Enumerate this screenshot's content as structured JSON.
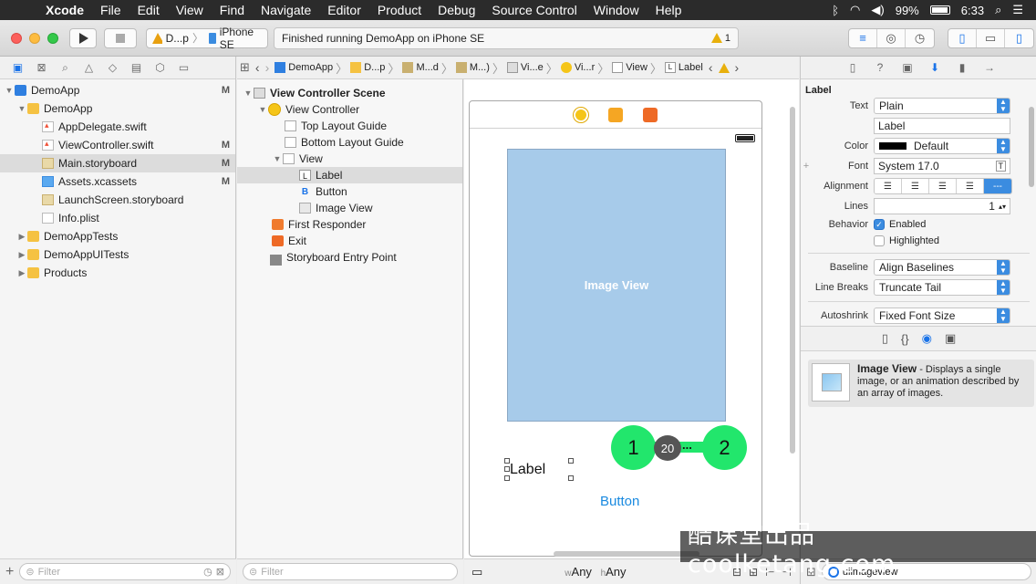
{
  "menubar": {
    "app_name": "Xcode",
    "menus": [
      "File",
      "Edit",
      "View",
      "Find",
      "Navigate",
      "Editor",
      "Product",
      "Debug",
      "Source Control",
      "Window",
      "Help"
    ],
    "battery": "99%",
    "clock": "6:33"
  },
  "toolbar": {
    "scheme_app": "D...p",
    "scheme_device": "iPhone SE",
    "activity_text": "Finished running DemoApp on iPhone SE",
    "warning_count": "1"
  },
  "navigator": {
    "items": [
      {
        "label": "DemoApp",
        "status": "M"
      },
      {
        "label": "DemoApp",
        "status": ""
      },
      {
        "label": "AppDelegate.swift",
        "status": ""
      },
      {
        "label": "ViewController.swift",
        "status": "M"
      },
      {
        "label": "Main.storyboard",
        "status": "M"
      },
      {
        "label": "Assets.xcassets",
        "status": "M"
      },
      {
        "label": "LaunchScreen.storyboard",
        "status": ""
      },
      {
        "label": "Info.plist",
        "status": ""
      },
      {
        "label": "DemoAppTests",
        "status": ""
      },
      {
        "label": "DemoAppUITests",
        "status": ""
      },
      {
        "label": "Products",
        "status": ""
      }
    ],
    "filter_placeholder": "Filter"
  },
  "jumpbar": {
    "crumbs": [
      "DemoApp",
      "D...p",
      "M...d",
      "M...)",
      "Vi...e",
      "Vi...r",
      "View",
      "Label"
    ]
  },
  "outline": {
    "scene": "View Controller Scene",
    "items": [
      "View Controller",
      "Top Layout Guide",
      "Bottom Layout Guide",
      "View",
      "Label",
      "Button",
      "Image View",
      "First Responder",
      "Exit",
      "Storyboard Entry Point"
    ],
    "filter_placeholder": "Filter"
  },
  "canvas": {
    "image_view_text": "Image View",
    "label_text": "Label",
    "button_text": "Button",
    "marker_1": "1",
    "marker_2": "2",
    "spacing_value": "20",
    "spacing_dots": "...",
    "size_w_prefix": "w",
    "size_w": "Any",
    "size_h_prefix": "h",
    "size_h": "Any"
  },
  "inspector": {
    "section_title": "Label",
    "text_label": "Text",
    "text_value": "Plain",
    "text_content": "Label",
    "color_label": "Color",
    "color_value": "Default",
    "font_label": "Font",
    "font_value": "System 17.0",
    "alignment_label": "Alignment",
    "lines_label": "Lines",
    "lines_value": "1",
    "behavior_label": "Behavior",
    "enabled_label": "Enabled",
    "highlighted_label": "Highlighted",
    "baseline_label": "Baseline",
    "baseline_value": "Align Baselines",
    "linebreaks_label": "Line Breaks",
    "linebreaks_value": "Truncate Tail",
    "autoshrink_label": "Autoshrink",
    "autoshrink_value": "Fixed Font Size"
  },
  "library": {
    "item_title": "Image View",
    "item_desc": " - Displays a single image, or an animation described by an array of images.",
    "search_value": "uiimageview"
  },
  "watermark": "酷课堂出品 coolketang.com",
  "colors": {
    "accent": "#1a73e8",
    "marker": "#22e66c",
    "image_view": "#a7cbea"
  }
}
